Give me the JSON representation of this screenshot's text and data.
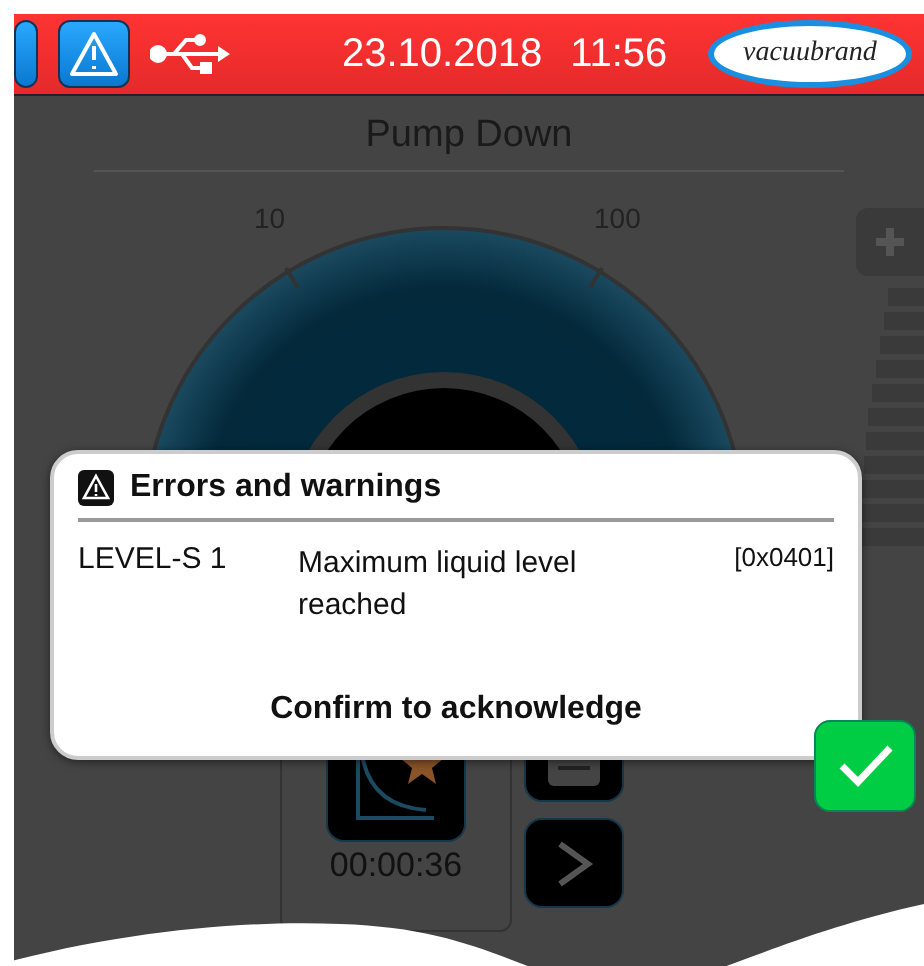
{
  "header": {
    "date": "23.10.2018",
    "time": "11:56",
    "logo": "vacuubrand"
  },
  "screen": {
    "title": "Pump Down",
    "gauge_ticks": [
      "10",
      "100"
    ],
    "timer": "00:00:36"
  },
  "dialog": {
    "title": "Errors and warnings",
    "errors": [
      {
        "code": "LEVEL-S 1",
        "message": "Maximum liquid level reached",
        "hex": "[0x0401]"
      }
    ],
    "footer": "Confirm to acknowledge"
  }
}
